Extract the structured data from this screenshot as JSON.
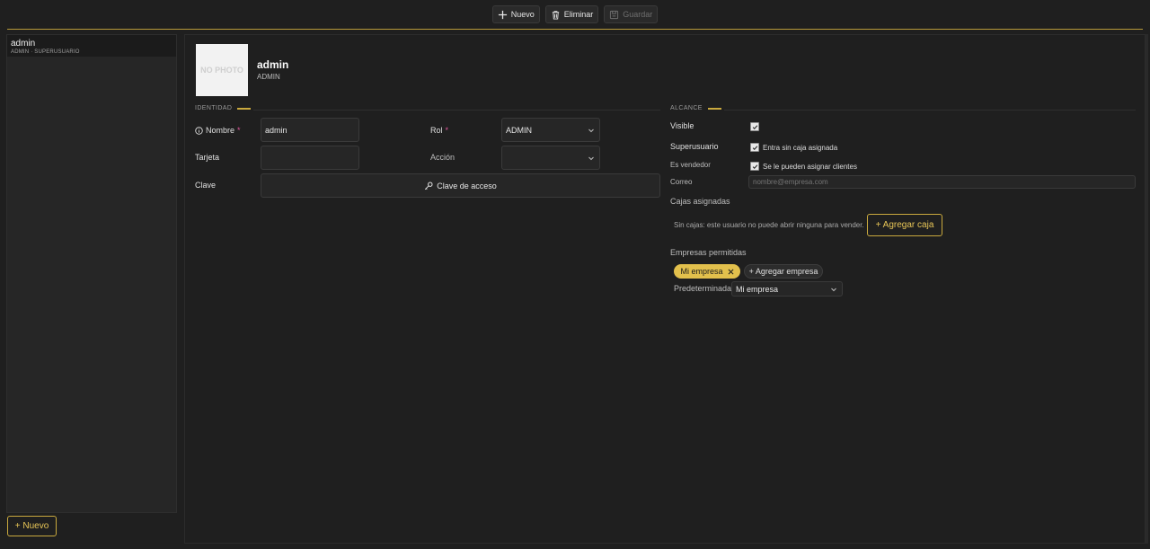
{
  "toolbar": {
    "new_label": "Nuevo",
    "delete_label": "Eliminar",
    "save_label": "Guardar"
  },
  "sidebar": {
    "items": [
      {
        "name": "admin",
        "subtitle": "ADMIN · SUPERUSUARIO"
      }
    ],
    "new_button": "+ Nuevo"
  },
  "profile": {
    "photo_placeholder": "NO PHOTO",
    "name": "admin",
    "role": "ADMIN"
  },
  "identidad": {
    "title": "IDENTIDAD",
    "nombre_label": "Nombre",
    "nombre_required": "*",
    "nombre_value": "admin",
    "rol_label": "Rol",
    "rol_required": "*",
    "rol_value": "ADMIN",
    "tarjeta_label": "Tarjeta",
    "tarjeta_value": "",
    "accion_label": "Acción",
    "accion_value": "",
    "clave_label": "Clave",
    "clave_button": "Clave de acceso"
  },
  "alcance": {
    "title": "ALCANCE",
    "visible_label": "Visible",
    "visible_checked": true,
    "superusuario_label": "Superusuario",
    "superusuario_option": "Entra sin caja asignada",
    "vendedor_label": "Es vendedor",
    "vendedor_option": "Se le pueden asignar clientes",
    "correo_label": "Correo",
    "correo_placeholder": "nombre@empresa.com",
    "cajas_label": "Cajas asignadas",
    "cajas_note": "Sin cajas: este usuario no puede abrir ninguna para vender.",
    "agregar_caja": "+ Agregar caja",
    "empresas_label": "Empresas permitidas",
    "empresa_chip": "Mi empresa",
    "agregar_empresa": "+ Agregar empresa",
    "predeterminada_label": "Predeterminada:",
    "predeterminada_value": "Mi empresa"
  },
  "colors": {
    "accent": "#c9a93e",
    "chip_bg": "#e2c04c",
    "required": "#e0569b",
    "background": "#1f1f1f"
  }
}
